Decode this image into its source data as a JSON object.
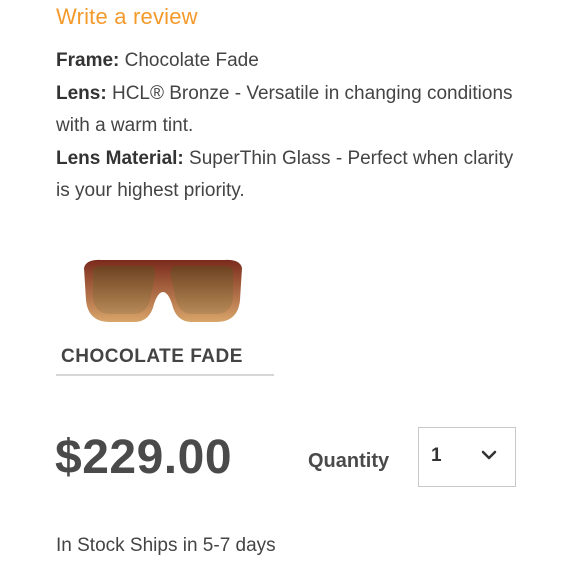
{
  "review_link": "Write a review",
  "specs": {
    "frame": {
      "label": "Frame:",
      "value": "Chocolate Fade"
    },
    "lens": {
      "label": "Lens:",
      "value": "HCL® Bronze - Versatile in changing conditions with a warm tint."
    },
    "lens_material": {
      "label": "Lens Material:",
      "value": "SuperThin Glass - Perfect when clarity is your highest priority."
    }
  },
  "swatch": {
    "label": "CHOCOLATE FADE",
    "frame_color_top": "#7a2a1c",
    "frame_color_bottom": "#d9a56a",
    "lens_color": "#8a5a2e"
  },
  "price": "$229.00",
  "quantity": {
    "label": "Quantity",
    "value": "1"
  },
  "stock_text": "In Stock Ships in 5-7 days",
  "colors": {
    "accent": "#f39a2b",
    "text": "#444444"
  }
}
